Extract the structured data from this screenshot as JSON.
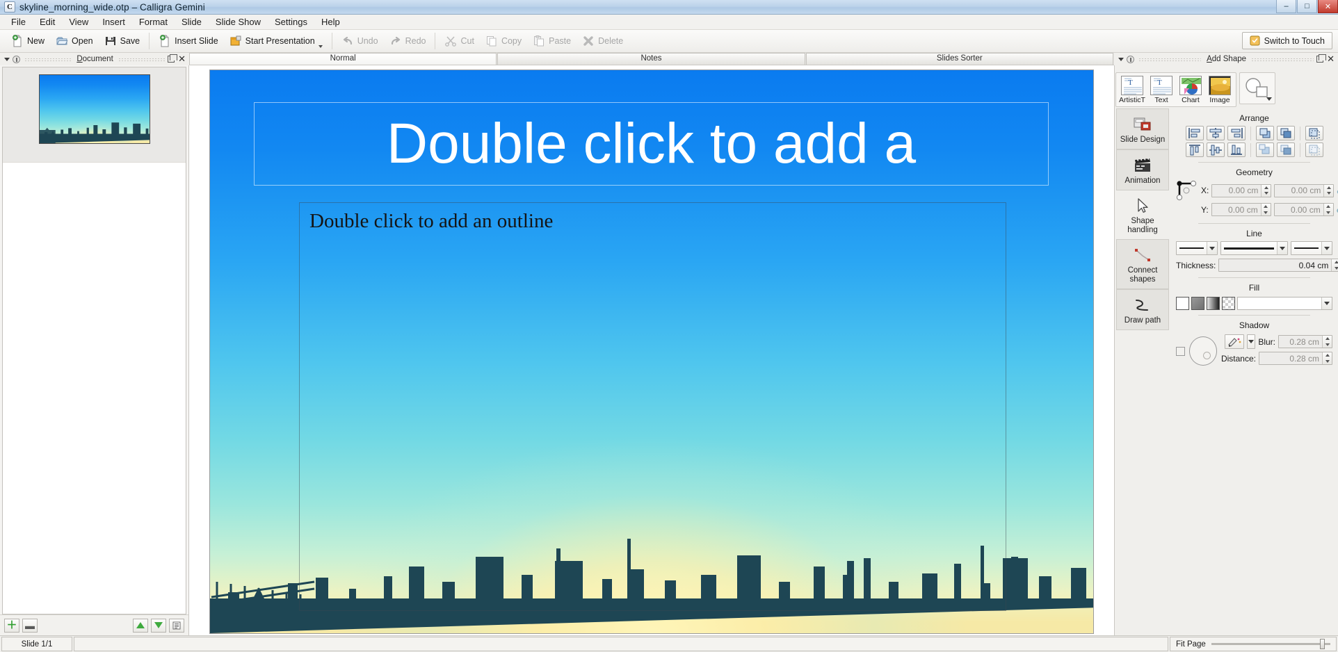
{
  "window": {
    "title": "skyline_morning_wide.otp – Calligra Gemini",
    "app_icon": "C",
    "minimize": "–",
    "maximize": "□",
    "close": "✕"
  },
  "menubar": {
    "items": [
      "File",
      "Edit",
      "View",
      "Insert",
      "Format",
      "Slide",
      "Slide Show",
      "Settings",
      "Help"
    ]
  },
  "toolbar": {
    "buttons": [
      {
        "label": "New",
        "icon": "new-document-icon",
        "enabled": true
      },
      {
        "label": "Open",
        "icon": "open-folder-icon",
        "enabled": true
      },
      {
        "label": "Save",
        "icon": "floppy-disk-icon",
        "enabled": true
      },
      {
        "label": "Insert Slide",
        "icon": "insert-slide-icon",
        "enabled": true
      },
      {
        "label": "Start Presentation",
        "icon": "start-presentation-icon",
        "enabled": true,
        "has_menu": true
      },
      {
        "label": "Undo",
        "icon": "undo-arrow-icon",
        "enabled": false
      },
      {
        "label": "Redo",
        "icon": "redo-arrow-icon",
        "enabled": false
      },
      {
        "label": "Cut",
        "icon": "scissors-icon",
        "enabled": false
      },
      {
        "label": "Copy",
        "icon": "copy-icon",
        "enabled": false
      },
      {
        "label": "Paste",
        "icon": "clipboard-paste-icon",
        "enabled": false
      },
      {
        "label": "Delete",
        "icon": "delete-cross-icon",
        "enabled": false
      }
    ],
    "switch_to_touch": "Switch to Touch"
  },
  "left_dock": {
    "title": "Document",
    "title_accel": "D",
    "float_icon": "undock-icon",
    "close_icon": "close-icon",
    "slides": [
      {
        "index": 1,
        "selected": true
      }
    ],
    "bottom_buttons": [
      {
        "name": "add-slide-button",
        "glyph": "+"
      },
      {
        "name": "remove-slide-button",
        "glyph": "–"
      },
      {
        "name": "move-slide-up-button",
        "glyph": "▲"
      },
      {
        "name": "move-slide-down-button",
        "glyph": "▼"
      },
      {
        "name": "slide-options-button",
        "glyph": "≣"
      }
    ]
  },
  "view_tabs": [
    {
      "label": "Normal",
      "active": true
    },
    {
      "label": "Notes",
      "active": false
    },
    {
      "label": "Slides Sorter",
      "active": false
    }
  ],
  "slide": {
    "title_placeholder": "Double click to add a",
    "outline_placeholder": "Double click to add an outline",
    "background_name": "morning-skyline-gradient",
    "colors": {
      "sky_top": "#0a7bf0",
      "sky_mid": "#4fc6ee",
      "sky_low": "#c6f0d6",
      "horizon_glow": "#f6e9a6",
      "skyline_silhouette": "#1e4654"
    }
  },
  "right_dock": {
    "title": "Add Shape",
    "title_accel": "A",
    "float_icon": "undock-icon",
    "close_icon": "close-icon",
    "shape_tools": [
      {
        "label": "ArtisticT",
        "icon": "artistic-text-icon"
      },
      {
        "label": "Text",
        "icon": "text-shape-icon"
      },
      {
        "label": "Chart",
        "icon": "chart-shape-icon"
      },
      {
        "label": "Image",
        "icon": "image-shape-icon"
      }
    ],
    "more_shapes": {
      "name": "more-shapes-button",
      "icon": "shapes-collection-icon"
    }
  },
  "tool_tabs": [
    {
      "label": "Slide Design",
      "icon": "slide-design-icon",
      "active": true
    },
    {
      "label": "Animation",
      "icon": "clapperboard-icon",
      "active": true
    },
    {
      "label": "Shape handling",
      "icon": "cursor-arrow-icon",
      "active": false
    },
    {
      "label": "Connect shapes",
      "icon": "connect-shapes-icon",
      "active": true
    },
    {
      "label": "Draw path",
      "icon": "draw-path-icon",
      "active": true
    }
  ],
  "properties": {
    "arrange": {
      "title": "Arrange",
      "row1": [
        "align-left-icon",
        "align-center-horizontal-icon",
        "align-right-icon",
        "bring-to-front-icon",
        "bring-forward-icon",
        "group-icon"
      ],
      "row2": [
        "align-top-icon",
        "align-center-vertical-icon",
        "align-bottom-icon",
        "send-backward-icon",
        "send-to-back-icon",
        "ungroup-icon"
      ]
    },
    "geometry": {
      "title": "Geometry",
      "anchor_icon": "anchor-point-selector",
      "x_label": "X:",
      "y_label": "Y:",
      "x_value": "0.00 cm",
      "width_value": "0.00 cm",
      "y_value": "0.00 cm",
      "height_value": "0.00 cm",
      "lock_ratio_icon": "chain-link-icon"
    },
    "line": {
      "title": "Line",
      "start_marker": "line-start-marker-combo",
      "style": "line-style-combo",
      "end_marker": "line-end-marker-combo",
      "thickness_label": "Thickness:",
      "thickness_value": "0.04 cm",
      "more_button": "...",
      "color_button": "line-color-button"
    },
    "fill": {
      "title": "Fill",
      "swatches": [
        "fill-none-swatch",
        "fill-solid-swatch",
        "fill-gradient-swatch",
        "fill-pattern-swatch"
      ],
      "color_combo": "fill-color-combo"
    },
    "shadow": {
      "title": "Shadow",
      "enabled_checkbox": "shadow-enabled-checkbox",
      "angle_dial": "shadow-angle-dial",
      "color_button": "shadow-color-button",
      "blur_label": "Blur:",
      "blur_value": "0.28 cm",
      "distance_label": "Distance:",
      "distance_value": "0.28 cm"
    }
  },
  "statusbar": {
    "slide_counter": "Slide 1/1",
    "zoom_label": "Fit Page"
  }
}
